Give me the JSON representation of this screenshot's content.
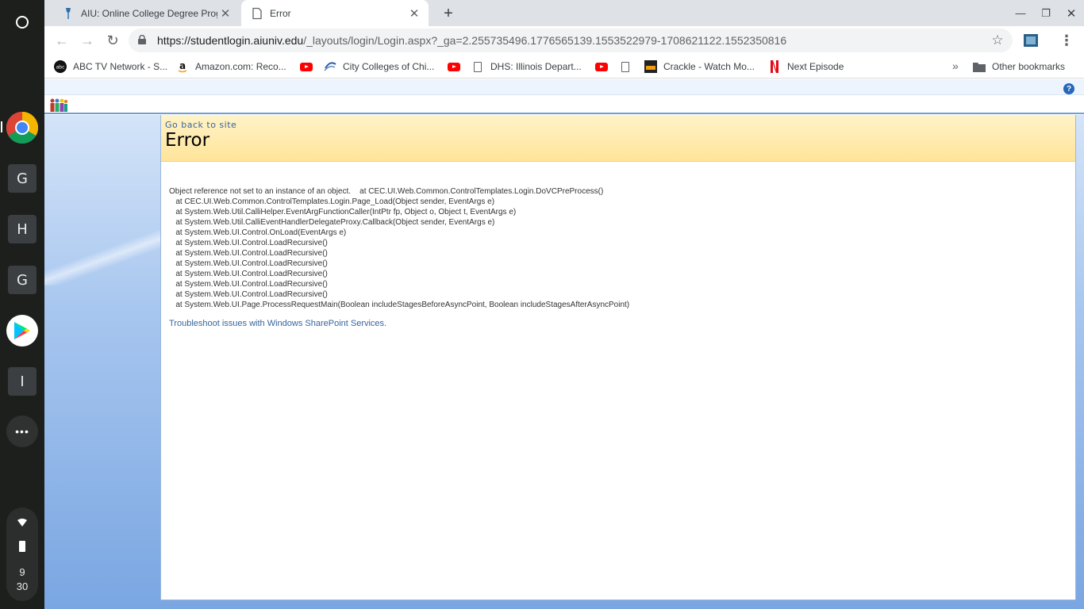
{
  "shelf": {
    "apps": [
      "G",
      "H",
      "G",
      "I"
    ],
    "time_hour": "9",
    "time_min": "30"
  },
  "browser": {
    "tabs": [
      {
        "title": "AIU: Online College Degree Progr"
      },
      {
        "title": "Error"
      }
    ],
    "url_host": "https://studentlogin.aiuniv.edu",
    "url_path": "/_layouts/login/Login.aspx?_ga=2.255735496.1776565139.1553522979-1708621122.1552350816",
    "bookmarks": [
      "ABC TV Network - S...",
      "Amazon.com: Reco...",
      "City Colleges of Chi...",
      "DHS: Illinois Depart...",
      "Crackle - Watch Mo...",
      "Next Episode"
    ],
    "other_bookmarks": "Other bookmarks"
  },
  "page": {
    "go_back": "Go back to site",
    "title": "Error",
    "trace_lines": [
      "Object reference not set to an instance of an object.    at CEC.UI.Web.Common.ControlTemplates.Login.DoVCPreProcess()",
      "   at CEC.UI.Web.Common.ControlTemplates.Login.Page_Load(Object sender, EventArgs e)",
      "   at System.Web.Util.CalliHelper.EventArgFunctionCaller(IntPtr fp, Object o, Object t, EventArgs e)",
      "   at System.Web.Util.CalliEventHandlerDelegateProxy.Callback(Object sender, EventArgs e)",
      "   at System.Web.UI.Control.OnLoad(EventArgs e)",
      "   at System.Web.UI.Control.LoadRecursive()",
      "   at System.Web.UI.Control.LoadRecursive()",
      "   at System.Web.UI.Control.LoadRecursive()",
      "   at System.Web.UI.Control.LoadRecursive()",
      "   at System.Web.UI.Control.LoadRecursive()",
      "   at System.Web.UI.Control.LoadRecursive()",
      "   at System.Web.UI.Page.ProcessRequestMain(Boolean includeStagesBeforeAsyncPoint, Boolean includeStagesAfterAsyncPoint)"
    ],
    "troubleshoot_link": "Troubleshoot issues with Windows SharePoint Services."
  }
}
